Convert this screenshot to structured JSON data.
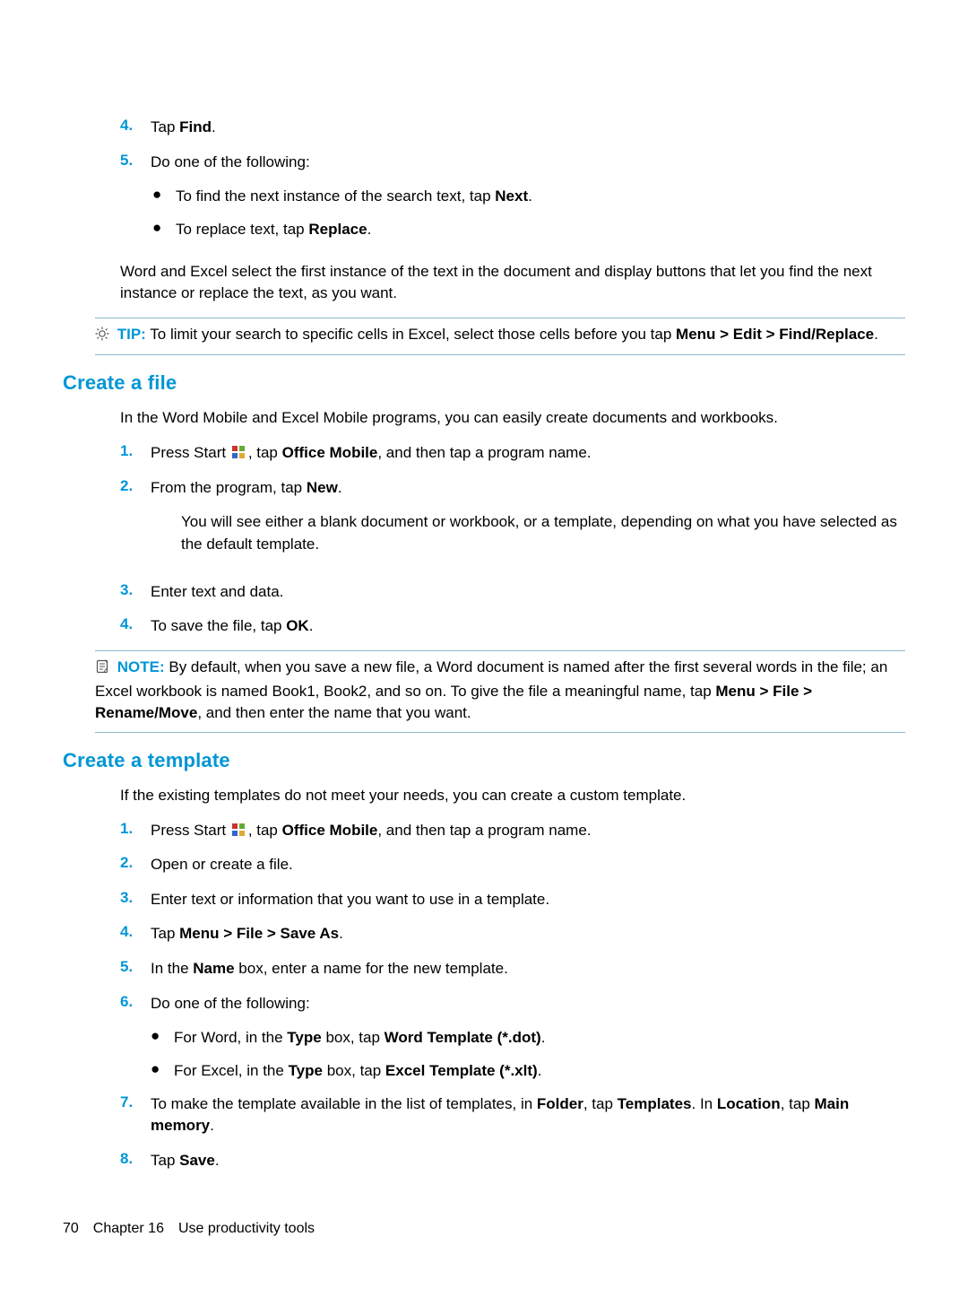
{
  "ol1": {
    "n4": "4.",
    "t4": "Tap <b>Find</b>.",
    "n5": "5.",
    "t5": "Do one of the following:",
    "b1": "To find the next instance of the search text, tap <b>Next</b>.",
    "b2": "To replace text, tap <b>Replace</b>."
  },
  "para1": "Word and Excel select the first instance of the text in the document and display buttons that let you find the next instance or replace the text, as you want.",
  "tip1": {
    "label": "TIP:",
    "text": "To limit your search to specific cells in Excel, select those cells before you tap <b>Menu > Edit > Find/Replace</b>."
  },
  "secA": {
    "title": "Create a file",
    "intro": "In the Word Mobile and Excel Mobile programs, you can easily create documents and workbooks.",
    "s1n": "1.",
    "s1t": "Press Start {win}, tap <b>Office Mobile</b>, and then tap a program name.",
    "s2n": "2.",
    "s2t": "From the program, tap <b>New</b>.",
    "s2sub": "You will see either a blank document or workbook, or a template, depending on what you have selected as the default template.",
    "s3n": "3.",
    "s3t": "Enter text and data.",
    "s4n": "4.",
    "s4t": "To save the file, tap <b>OK</b>.",
    "note": {
      "label": "NOTE:",
      "text": "By default, when you save a new file, a Word document is named after the first several words in the file; an Excel workbook is named Book1, Book2, and so on. To give the file a meaningful name, tap <b>Menu > File > Rename/Move</b>, and then enter the name that you want."
    }
  },
  "secB": {
    "title": "Create a template",
    "intro": "If the existing templates do not meet your needs, you can create a custom template.",
    "s1n": "1.",
    "s1t": "Press Start {win}, tap <b>Office Mobile</b>, and then tap a program name.",
    "s2n": "2.",
    "s2t": "Open or create a file.",
    "s3n": "3.",
    "s3t": "Enter text or information that you want to use in a template.",
    "s4n": "4.",
    "s4t": "Tap <b>Menu > File > Save As</b>.",
    "s5n": "5.",
    "s5t": "In the <b>Name</b> box, enter a name for the new template.",
    "s6n": "6.",
    "s6t": "Do one of the following:",
    "b1": "For Word, in the <b>Type</b> box, tap <b>Word Template (*.dot)</b>.",
    "b2": "For Excel, in the <b>Type</b> box, tap <b>Excel Template (*.xlt)</b>.",
    "s7n": "7.",
    "s7t": "To make the template available in the list of templates, in <b>Folder</b>, tap <b>Templates</b>. In <b>Location</b>, tap <b>Main memory</b>.",
    "s8n": "8.",
    "s8t": "Tap <b>Save</b>."
  },
  "footer": "70 Chapter 16 Use productivity tools"
}
